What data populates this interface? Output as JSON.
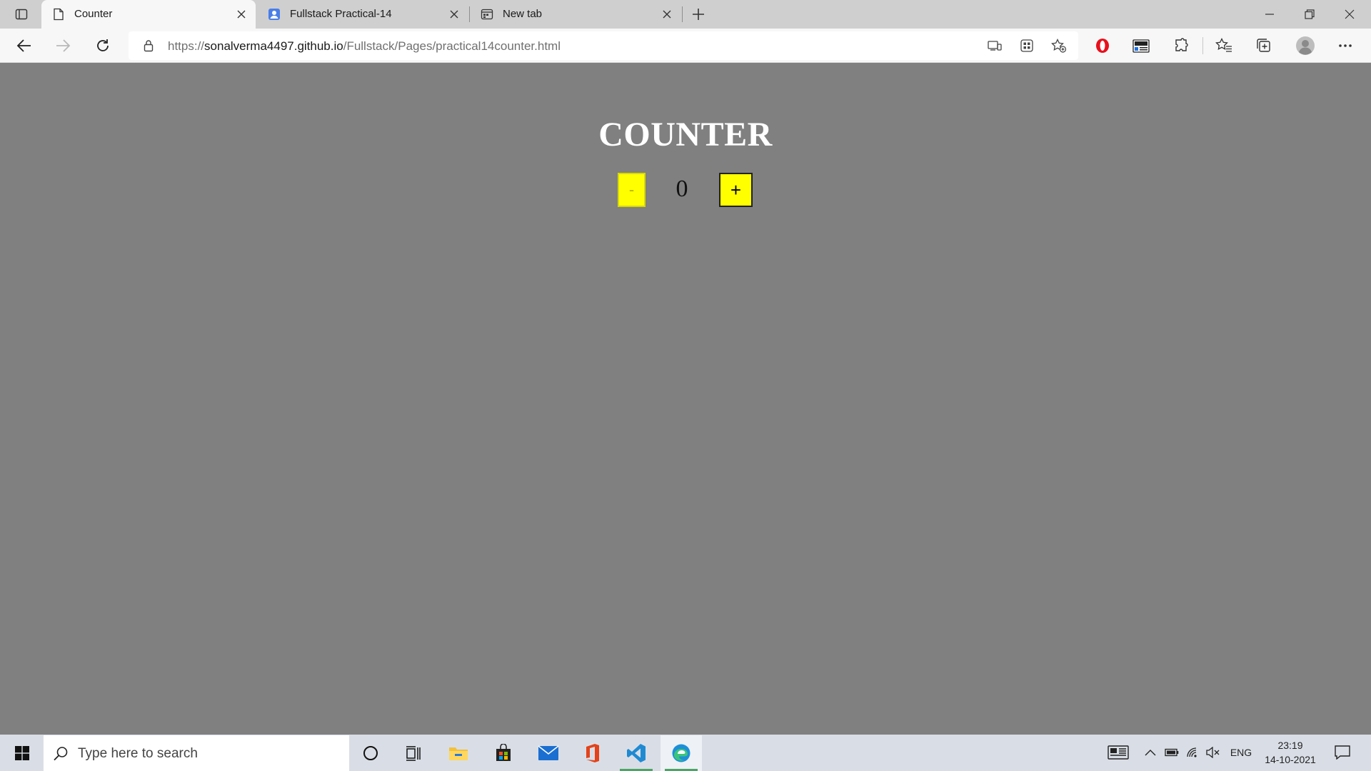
{
  "browser": {
    "tabs": [
      {
        "title": "Counter",
        "icon": "page-icon",
        "active": true
      },
      {
        "title": "Fullstack Practical-14",
        "icon": "contact-icon",
        "active": false
      },
      {
        "title": "New tab",
        "icon": "newtab-icon",
        "active": false
      }
    ],
    "address": {
      "prefix": "https://",
      "host": "sonalverma4497.github.io",
      "path": "/Fullstack/Pages/practical14counter.html"
    }
  },
  "page": {
    "title": "COUNTER",
    "decrement_label": "-",
    "increment_label": "+",
    "count": "0",
    "background_color": "#808080",
    "button_color": "#ffff00"
  },
  "taskbar": {
    "search_placeholder": "Type here to search",
    "language": "ENG",
    "time": "23:19",
    "date": "14-10-2021"
  }
}
